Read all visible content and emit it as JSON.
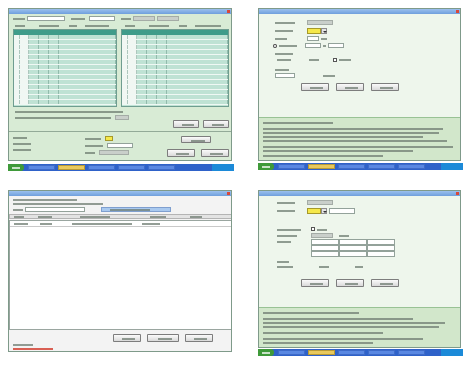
{
  "colors": {
    "title_bar": "#6f9fdc",
    "form_background": "#d8ebd5",
    "form_background_light": "#eef6ec",
    "table_header": "#3f9c8a",
    "table_row": "#bfe2d4",
    "highlight_field": "#f5e84a",
    "info_panel": "#d2e7cb",
    "taskbar": "#2f62c9",
    "start_button": "#3f9a3a",
    "selection": "#a9c9ef",
    "list_background": "#ffffff"
  },
  "icons": {
    "window_close": "close-icon",
    "dropdown": "chevron-down-icon",
    "taskbar_start": "start-icon",
    "radio": "radio-icon",
    "checkbox": "checkbox-icon"
  }
}
